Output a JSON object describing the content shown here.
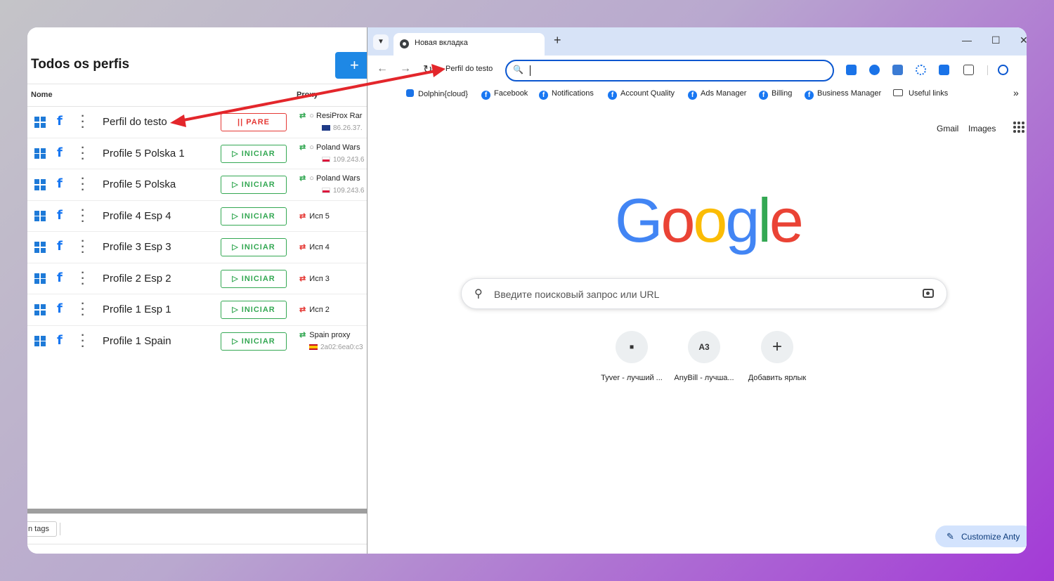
{
  "profiles_app": {
    "title": "Todos os perfis",
    "add_label": "+",
    "columns": {
      "name": "Nome",
      "proxy": "Proxy"
    },
    "rows": [
      {
        "name": "Perfil do testo",
        "action": "|| PARE",
        "proxy_name": "ResiProx Rar",
        "proxy_ip": "86.26.37.",
        "flag": "uk",
        "arrows": "⇄",
        "mode": "stop"
      },
      {
        "name": "Profile 5 Polska 1",
        "action": "▷ INICIAR",
        "proxy_name": "Poland Wars",
        "proxy_ip": "109.243.6",
        "flag": "pl",
        "arrows": "⇄",
        "mode": "start"
      },
      {
        "name": "Profile 5 Polska",
        "action": "▷ INICIAR",
        "proxy_name": "Poland Wars",
        "proxy_ip": "109.243.6",
        "flag": "pl",
        "arrows": "⇄",
        "mode": "start"
      },
      {
        "name": "Profile 4 Esp 4",
        "action": "▷ INICIAR",
        "proxy_name": "Исп 5",
        "proxy_ip": "",
        "flag": "",
        "arrows": "⇄",
        "mode": "start"
      },
      {
        "name": "Profile 3 Esp 3",
        "action": "▷ INICIAR",
        "proxy_name": "Исп 4",
        "proxy_ip": "",
        "flag": "",
        "arrows": "⇄",
        "mode": "start"
      },
      {
        "name": "Profile 2 Esp 2",
        "action": "▷ INICIAR",
        "proxy_name": "Исп 3",
        "proxy_ip": "",
        "flag": "",
        "arrows": "⇄",
        "mode": "start"
      },
      {
        "name": "Profile 1 Esp 1",
        "action": "▷ INICIAR",
        "proxy_name": "Исп 2",
        "proxy_ip": "",
        "flag": "",
        "arrows": "⇄",
        "mode": "start"
      },
      {
        "name": "Profile 1 Spain",
        "action": "▷ INICIAR",
        "proxy_name": "Spain proxy",
        "proxy_ip": "2a02:6ea0:c3",
        "flag": "es",
        "arrows": "⇄",
        "mode": "start"
      }
    ],
    "tags_label": "n tags"
  },
  "browser": {
    "tab_title": "Новая вкладка",
    "new_tab": "+",
    "window_controls": {
      "minimize": "—",
      "maximize": "☐",
      "close": "✕"
    },
    "nav": {
      "back": "←",
      "forward": "→",
      "reload": "↻"
    },
    "drag_label": "Perfil do testo",
    "omnibox_icon": "🔍",
    "bookmarks": [
      {
        "label": "Dolphin{cloud}",
        "icon": "dolphin"
      },
      {
        "label": "Facebook",
        "icon": "facebook"
      },
      {
        "label": "Notifications",
        "icon": "facebook"
      },
      {
        "label": "Account Quality",
        "icon": "facebook"
      },
      {
        "label": "Ads Manager",
        "icon": "facebook"
      },
      {
        "label": "Billing",
        "icon": "facebook"
      },
      {
        "label": "Business Manager",
        "icon": "facebook"
      },
      {
        "label": "Useful links",
        "icon": "folder"
      }
    ],
    "bookmarks_more": "»",
    "apps_icon": "⊞",
    "google": {
      "gmail": "Gmail",
      "images": "Images",
      "logo_letters": [
        {
          "ch": "G",
          "color": "#4285F4"
        },
        {
          "ch": "o",
          "color": "#EA4335"
        },
        {
          "ch": "o",
          "color": "#FBBC05"
        },
        {
          "ch": "g",
          "color": "#4285F4"
        },
        {
          "ch": "l",
          "color": "#34A853"
        },
        {
          "ch": "e",
          "color": "#EA4335"
        }
      ],
      "search_placeholder": "Введите поисковый запрос или URL",
      "shortcuts": [
        {
          "label": "Tyver - лучший ...",
          "glyph": "▪"
        },
        {
          "label": "AnyBill - лучша...",
          "glyph": "A3"
        },
        {
          "label": "Добавить ярлык",
          "glyph": "+"
        }
      ],
      "customize_label": "Customize Anty",
      "customize_icon": "✎"
    }
  },
  "colors": {
    "accent": "#1e88e5",
    "start": "#34a853",
    "stop": "#e53935",
    "annotation_arrow": "#e3262b"
  }
}
